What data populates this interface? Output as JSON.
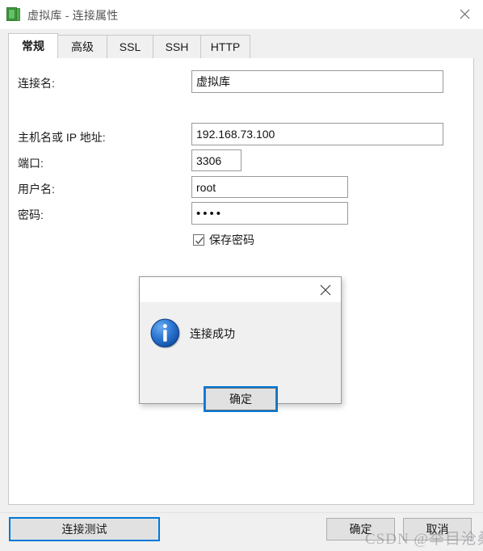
{
  "window": {
    "title": "虚拟库 - 连接属性",
    "icon": "database-green-icon",
    "close_label": "✕"
  },
  "tabs": [
    {
      "label": "常规",
      "active": true
    },
    {
      "label": "高级",
      "active": false
    },
    {
      "label": "SSL",
      "active": false
    },
    {
      "label": "SSH",
      "active": false
    },
    {
      "label": "HTTP",
      "active": false
    }
  ],
  "form": {
    "connection_name": {
      "label": "连接名:",
      "value": "虚拟库"
    },
    "host": {
      "label": "主机名或 IP 地址:",
      "value": "192.168.73.100"
    },
    "port": {
      "label": "端口:",
      "value": "3306"
    },
    "username": {
      "label": "用户名:",
      "value": "root"
    },
    "password": {
      "label": "密码:",
      "value": "••••"
    },
    "save_password": {
      "label": "保存密码",
      "checked": true
    }
  },
  "buttons": {
    "test_connection": "连接测试",
    "ok": "确定",
    "cancel": "取消"
  },
  "modal": {
    "icon": "info-icon",
    "message": "连接成功",
    "ok_label": "确定",
    "close_label": "✕"
  },
  "watermark": "CSDN @举目沧桑",
  "colors": {
    "accent": "#0078d7",
    "window_bg": "#f0f0f0",
    "panel_bg": "#ffffff",
    "info_blue": "#1a66c9",
    "icon_green": "#3a9c3a"
  }
}
